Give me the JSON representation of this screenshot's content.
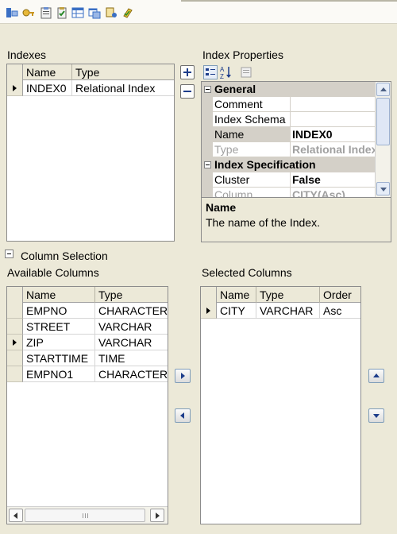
{
  "toolbar": {
    "icons": [
      "table-icon",
      "key-icon",
      "clipboard-icon",
      "clipboard-check-icon",
      "grid-icon",
      "window-icon",
      "properties-icon",
      "check-icon"
    ]
  },
  "indexes": {
    "title": "Indexes",
    "columns": [
      "Name",
      "Type"
    ],
    "rows": [
      {
        "name": "INDEX0",
        "type": "Relational Index",
        "selected": true
      }
    ]
  },
  "index_properties": {
    "title": "Index Properties",
    "categories": [
      {
        "name": "General",
        "rows": [
          {
            "name": "Comment",
            "value": ""
          },
          {
            "name": "Index Schema",
            "value": ""
          },
          {
            "name": "Name",
            "value": "INDEX0",
            "bold": true,
            "selected": true
          },
          {
            "name": "Type",
            "value": "Relational Index",
            "disabled": true
          }
        ]
      },
      {
        "name": "Index Specification",
        "rows": [
          {
            "name": "Cluster",
            "value": "False",
            "bold": true
          },
          {
            "name": "Column",
            "value": "CITY(Asc)",
            "disabled": true
          }
        ]
      }
    ],
    "description_title": "Name",
    "description_text": "The name of the Index."
  },
  "column_selection": {
    "title": "Column Selection",
    "available": {
      "title": "Available Columns",
      "columns": [
        "Name",
        "Type"
      ],
      "rows": [
        {
          "name": "EMPNO",
          "type": "CHARACTER"
        },
        {
          "name": "STREET",
          "type": "VARCHAR"
        },
        {
          "name": "ZIP",
          "type": "VARCHAR",
          "selected": true
        },
        {
          "name": "STARTTIME",
          "type": "TIME"
        },
        {
          "name": "EMPNO1",
          "type": "CHARACTER"
        }
      ]
    },
    "selected": {
      "title": "Selected Columns",
      "columns": [
        "Name",
        "Type",
        "Order"
      ],
      "rows": [
        {
          "name": "CITY",
          "type": "VARCHAR",
          "order": "Asc"
        }
      ]
    }
  },
  "colors": {
    "window_bg": "#ece9d8",
    "header_bg": "#ece9d8",
    "category_bg": "#d4d0c8",
    "border": "#8c8c8c",
    "arrow_blue": "#1d3d8b"
  }
}
